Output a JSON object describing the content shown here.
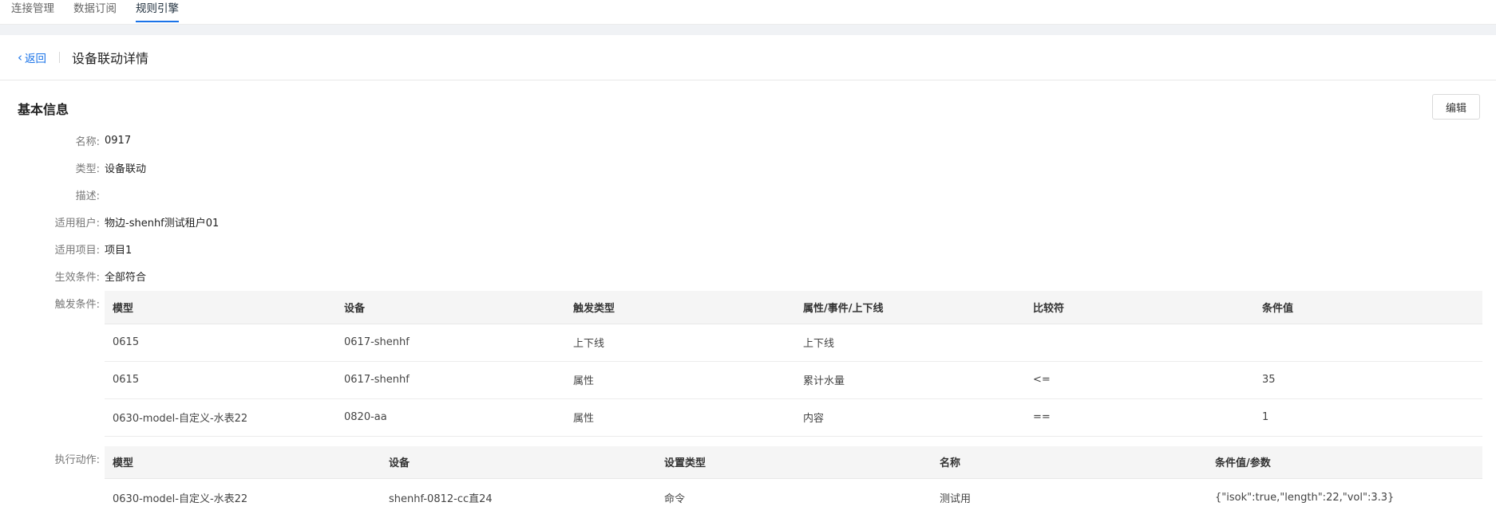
{
  "top_tabs": [
    {
      "label": "连接管理",
      "active": false
    },
    {
      "label": "数据订阅",
      "active": false
    },
    {
      "label": "规则引擎",
      "active": true
    }
  ],
  "header": {
    "back_label": "返回",
    "back_icon": "chevron-left-icon",
    "title": "设备联动详情"
  },
  "basic_info": {
    "section_title": "基本信息",
    "edit_label": "编辑",
    "fields": [
      {
        "label": "名称:",
        "value": "0917"
      },
      {
        "label": "类型:",
        "value": "设备联动"
      },
      {
        "label": "描述:",
        "value": ""
      },
      {
        "label": "适用租户:",
        "value": "物边-shenhf测试租户01"
      },
      {
        "label": "适用项目:",
        "value": "项目1"
      },
      {
        "label": "生效条件:",
        "value": "全部符合"
      }
    ]
  },
  "triggers": {
    "label": "触发条件:",
    "columns": [
      "模型",
      "设备",
      "触发类型",
      "属性/事件/上下线",
      "比较符",
      "条件值"
    ],
    "rows": [
      [
        "0615",
        "0617-shenhf",
        "上下线",
        "上下线",
        "",
        ""
      ],
      [
        "0615",
        "0617-shenhf",
        "属性",
        "累计水量",
        "<=",
        "35"
      ],
      [
        "0630-model-自定义-水表22",
        "0820-aa",
        "属性",
        "内容",
        "==",
        "1"
      ]
    ]
  },
  "actions": {
    "label": "执行动作:",
    "columns": [
      "模型",
      "设备",
      "设置类型",
      "名称",
      "条件值/参数"
    ],
    "rows": [
      [
        "0630-model-自定义-水表22",
        "shenhf-0812-cc直24",
        "命令",
        "测试用",
        "{\"isok\":true,\"length\":22,\"vol\":3.3}"
      ]
    ]
  }
}
